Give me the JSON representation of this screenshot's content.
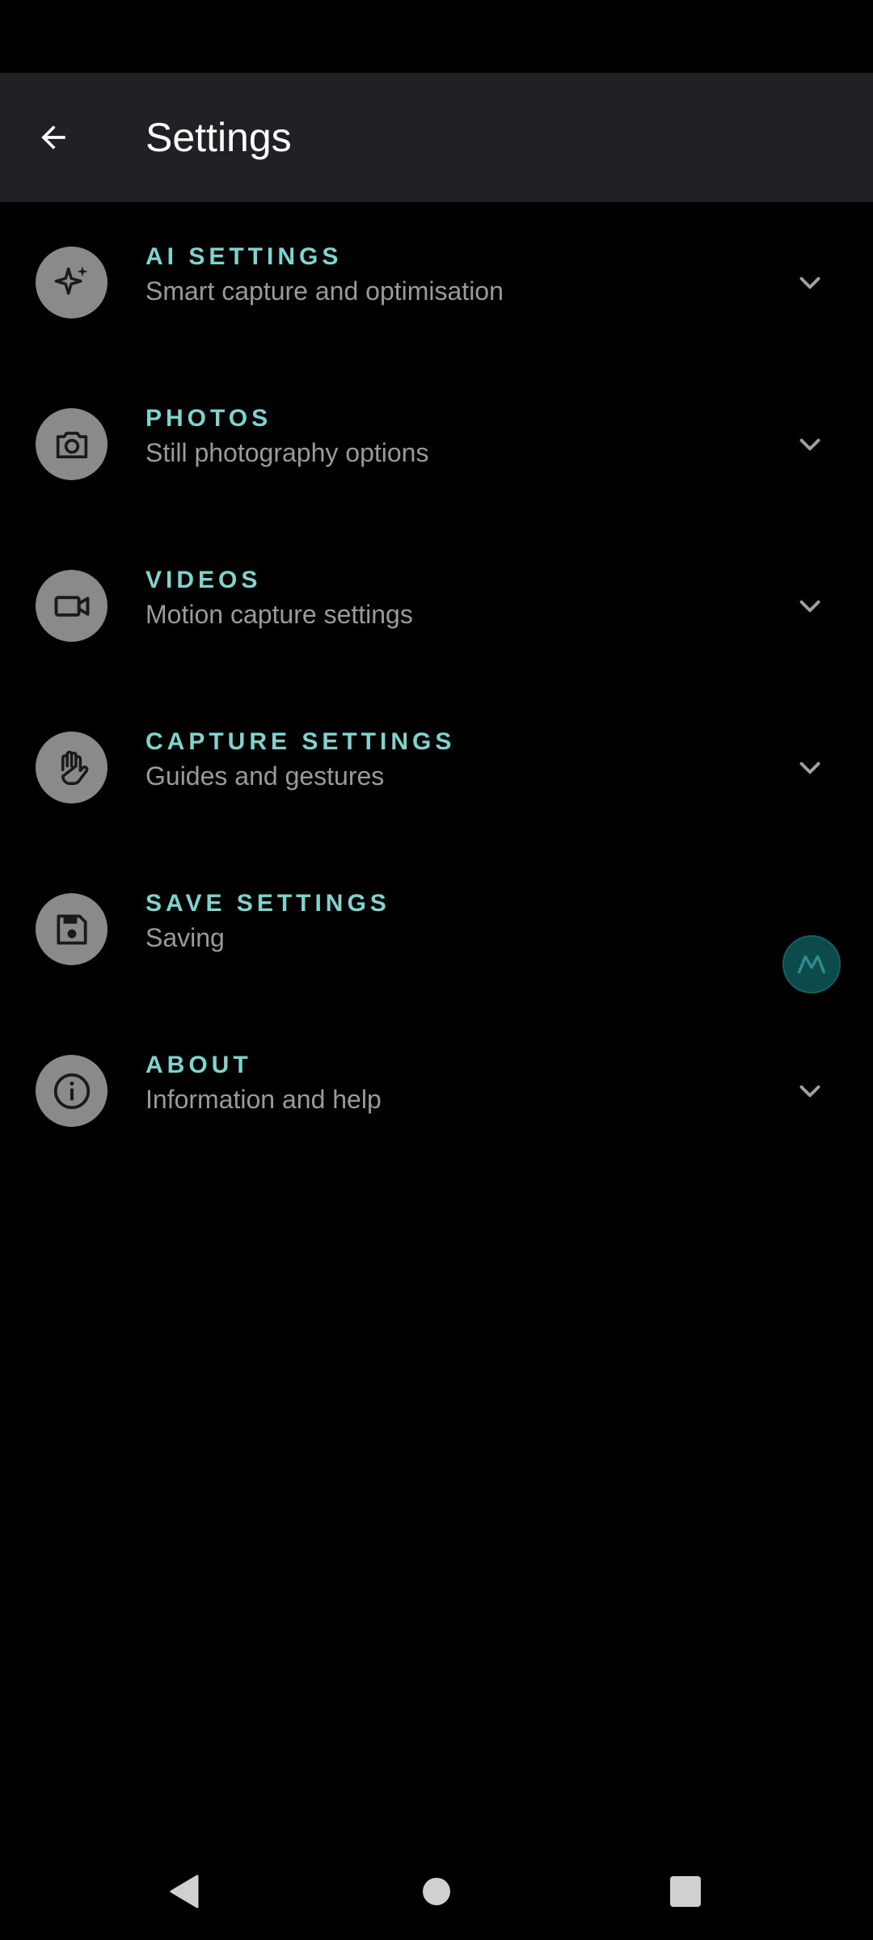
{
  "app_bar": {
    "title": "Settings",
    "back_icon": "arrow-back-icon"
  },
  "settings": {
    "items": [
      {
        "title": "AI SETTINGS",
        "subtitle": "Smart capture and optimisation",
        "icon": "sparkle-icon",
        "trailing": "chevron-down-icon"
      },
      {
        "title": "PHOTOS",
        "subtitle": "Still photography options",
        "icon": "camera-icon",
        "trailing": "chevron-down-icon"
      },
      {
        "title": "VIDEOS",
        "subtitle": "Motion capture settings",
        "icon": "video-camera-icon",
        "trailing": "chevron-down-icon"
      },
      {
        "title": "CAPTURE SETTINGS",
        "subtitle": "Guides and gestures",
        "icon": "hand-icon",
        "trailing": "chevron-down-icon"
      },
      {
        "title": "SAVE SETTINGS",
        "subtitle": "Saving",
        "icon": "save-icon",
        "trailing": "motorola-logo-icon"
      },
      {
        "title": "ABOUT",
        "subtitle": "Information and help",
        "icon": "info-icon",
        "trailing": "chevron-down-icon"
      }
    ]
  },
  "nav_bar": {
    "back": "nav-back-triangle-icon",
    "home": "nav-home-circle-icon",
    "recents": "nav-recents-square-icon"
  },
  "colors": {
    "background": "#000000",
    "app_bar": "#1f2124",
    "accent_title": "#7fd4cf",
    "subtitle": "#9a9a9a",
    "icon_circle": "#8a8a8a",
    "chevron": "#a0a0a0",
    "moto_badge": "#0d4a4c"
  }
}
